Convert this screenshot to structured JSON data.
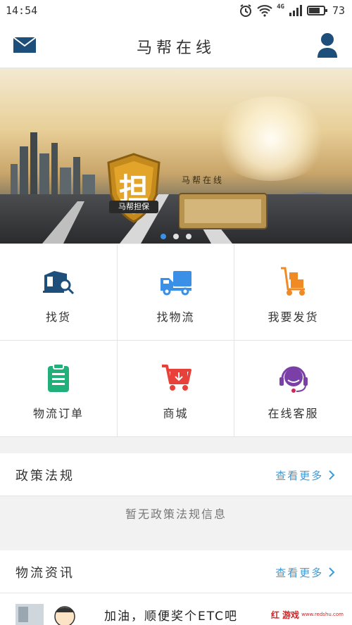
{
  "status_bar": {
    "time": "14:54",
    "network_label": "4G",
    "battery": "73"
  },
  "header": {
    "title": "马帮在线",
    "mail_icon": "mail-icon",
    "user_icon": "user-icon"
  },
  "banner": {
    "badge_char": "担",
    "badge_label": "马帮担保",
    "sign_title": "马帮在线",
    "slides": 3,
    "active_slide": 1
  },
  "services": [
    {
      "label": "找货",
      "icon": "search-goods-icon",
      "color": "#1d4f7a"
    },
    {
      "label": "找物流",
      "icon": "truck-icon",
      "color": "#3a8fe6"
    },
    {
      "label": "我要发货",
      "icon": "cart-boxes-icon",
      "color": "#f08a24"
    },
    {
      "label": "物流订单",
      "icon": "clipboard-icon",
      "color": "#22b07a"
    },
    {
      "label": "商城",
      "icon": "shopping-cart-icon",
      "color": "#e8413a"
    },
    {
      "label": "在线客服",
      "icon": "headset-icon",
      "color": "#7b3fa8"
    }
  ],
  "policy": {
    "title": "政策法规",
    "more": "查看更多",
    "empty": "暂无政策法规信息"
  },
  "news": {
    "title": "物流资讯",
    "more": "查看更多",
    "items": [
      {
        "title": "加油，顺便奖个ETC吧"
      }
    ]
  },
  "watermark": {
    "main": "红 游戏",
    "sub": "www.redshu.com"
  }
}
